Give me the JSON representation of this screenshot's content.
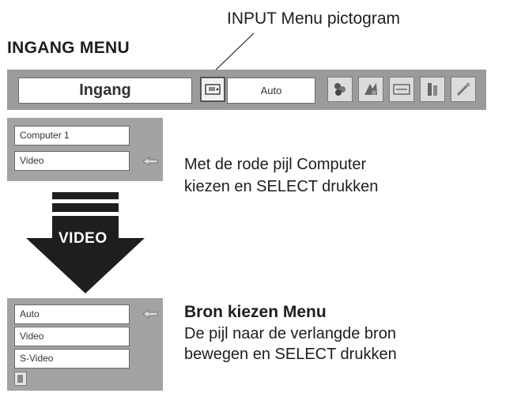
{
  "header": {
    "pictogram_caption": "INPUT Menu pictogram",
    "section_title": "INGANG MENU"
  },
  "menu_bar": {
    "title": "Ingang",
    "value": "Auto",
    "icons": [
      "input-icon",
      "color-icon",
      "image-icon",
      "screen-icon",
      "setting-icon",
      "info-icon"
    ]
  },
  "input_menu": {
    "items": [
      "Computer 1",
      "Video"
    ],
    "selected": "Video"
  },
  "transition": {
    "label": "VIDEO"
  },
  "instruction1": {
    "line1": "Met de rode pijl Computer",
    "line2": "kiezen en SELECT drukken"
  },
  "source_menu": {
    "items": [
      "Auto",
      "Video",
      "S-Video"
    ],
    "selected": "Auto",
    "footer_icon": "back-icon"
  },
  "instruction2": {
    "title": "Bron kiezen Menu",
    "line1": "De pijl naar de verlangde bron",
    "line2": "bewegen en SELECT drukken"
  },
  "colors": {
    "panel_gray": "#a3a3a3",
    "bar_gray": "#9b9b9b",
    "arrow": "#1e1e1e"
  }
}
